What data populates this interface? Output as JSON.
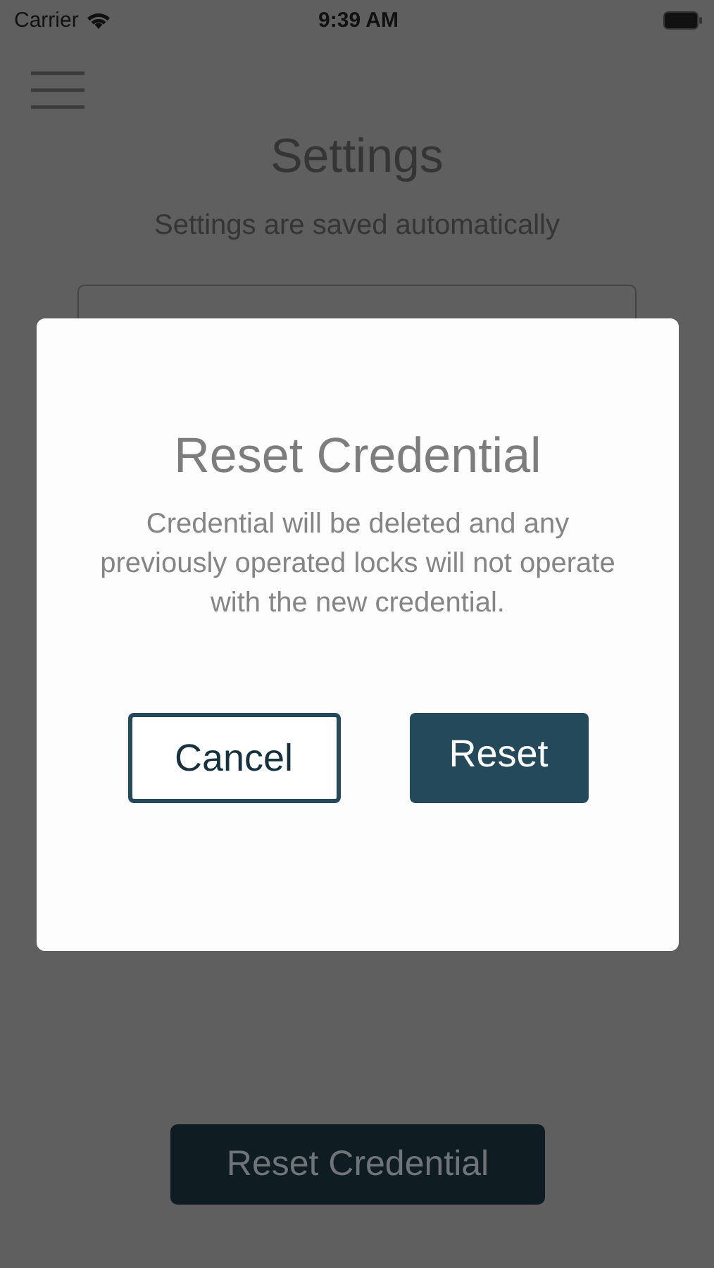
{
  "status_bar": {
    "carrier": "Carrier",
    "time": "9:39 AM"
  },
  "page": {
    "title": "Settings",
    "subtitle": "Settings are saved automatically",
    "action": "Reset Credential"
  },
  "dialog": {
    "title": "Reset Credential",
    "message": "Credential will be deleted and any previously operated locks will not operate with the new credential.",
    "buttons": [
      {
        "label": "Cancel",
        "kind": "secondary"
      },
      {
        "label": "Reset",
        "kind": "primary"
      }
    ]
  }
}
